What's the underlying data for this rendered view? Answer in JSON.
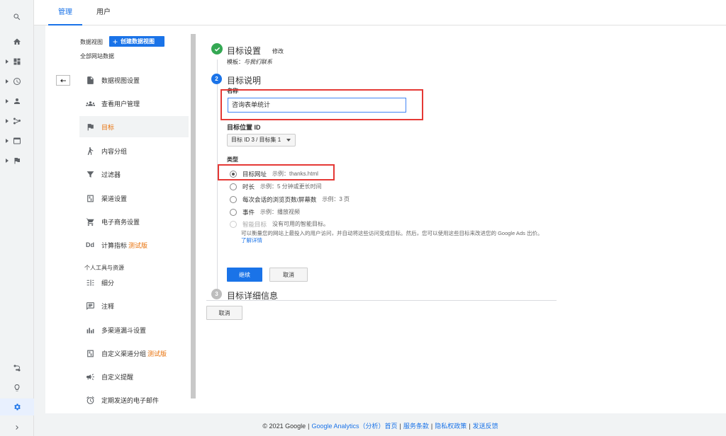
{
  "rail": {
    "icons": [
      "search-icon",
      "home-icon",
      "dashboard-icon",
      "clock-icon",
      "person-icon",
      "flow-icon",
      "display-icon",
      "flag-icon"
    ],
    "bottom_icons": [
      "attribution-icon",
      "lightbulb-icon",
      "settings-icon",
      "chevron-right-icon"
    ]
  },
  "tabs": {
    "admin": "管理",
    "user": "用户"
  },
  "side": {
    "view_label": "数据视图",
    "create_view": "创建数据视图",
    "all_data": "全部网站数据",
    "items": [
      {
        "label": "数据视图设置",
        "icon": "document-icon"
      },
      {
        "label": "查看用户管理",
        "icon": "people-icon"
      },
      {
        "label": "目标",
        "icon": "flag-icon"
      },
      {
        "label": "内容分组",
        "icon": "content-group-icon"
      },
      {
        "label": "过滤器",
        "icon": "filter-icon"
      },
      {
        "label": "渠道设置",
        "icon": "channel-icon"
      },
      {
        "label": "电子商务设置",
        "icon": "cart-icon"
      },
      {
        "label": "计算指标",
        "icon": "dd-icon",
        "beta": "测试版",
        "icon_text": "Dd"
      }
    ],
    "section": "个人工具与资源",
    "items2": [
      {
        "label": "细分",
        "icon": "segment-icon"
      },
      {
        "label": "注释",
        "icon": "comment-icon"
      },
      {
        "label": "多渠道漏斗设置",
        "icon": "bar-chart-icon"
      },
      {
        "label": "自定义渠道分组",
        "icon": "channel-group-icon",
        "beta": "测试版"
      },
      {
        "label": "自定义提醒",
        "icon": "megaphone-icon"
      },
      {
        "label": "定期发送的电子邮件",
        "icon": "alarm-icon"
      }
    ]
  },
  "goal": {
    "step1": {
      "title": "目标设置",
      "edit": "修改",
      "template_label": "模板：",
      "template_value": "与我们联系"
    },
    "step2": {
      "number": "2",
      "title": "目标说明",
      "name_label": "名称",
      "name_value": "咨询表单统计",
      "location_label": "目标位置 ID",
      "location_value": "目标 ID 3 / 目标集 1",
      "type_label": "类型",
      "types": [
        {
          "label": "目标网址",
          "example": "示例：thanks.html",
          "selected": true
        },
        {
          "label": "时长",
          "example": "示例：5 分钟或更长时间"
        },
        {
          "label": "每次会话的浏览页数/屏幕数",
          "example": "示例：3 页"
        },
        {
          "label": "事件",
          "example": "示例：播放视频"
        },
        {
          "label": "智能目标",
          "example": "没有可用的智能目标。",
          "disabled": true
        }
      ],
      "smart_note": "可以衡量您的网站上最投入的用户访问，并自动将这些访问变成目标。然后，您可以使用这些目标来改进您的 Google Ads 出价。",
      "learn_more": "了解详情",
      "continue": "继续",
      "cancel": "取消"
    },
    "step3": {
      "number": "3",
      "title": "目标详细信息"
    },
    "cancel_all": "取消"
  },
  "footer": {
    "copyright": "© 2021 Google",
    "product": "Google Analytics（分析）首页",
    "terms": "服务条款",
    "privacy": "隐私权政策",
    "feedback": "发送反馈"
  },
  "colors": {
    "accent": "#1a73e8",
    "active_orange": "#e8710a",
    "highlight_red": "#e53935",
    "success_green": "#34a853"
  }
}
